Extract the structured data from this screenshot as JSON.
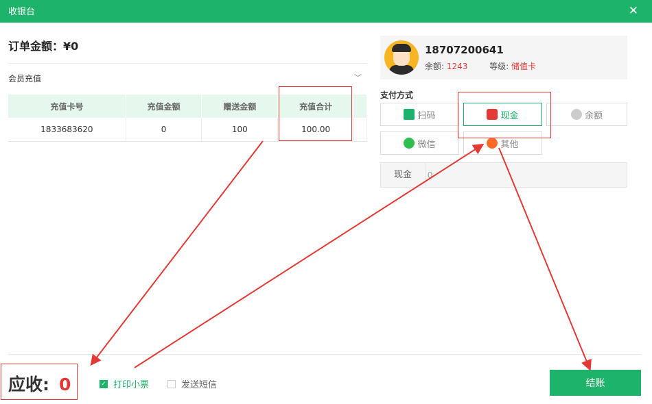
{
  "window": {
    "title": "收银台",
    "close_glyph": "✕"
  },
  "order": {
    "amount_label": "订单金额：",
    "amount_value": "¥0"
  },
  "section": {
    "selected": "会员充值"
  },
  "table": {
    "headers": [
      "充值卡号",
      "充值金额",
      "赠送金额",
      "充值合计"
    ],
    "rows": [
      [
        "1833683620",
        "0",
        "100",
        "100.00"
      ]
    ]
  },
  "member": {
    "phone": "18707200641",
    "balance_label": "余额:",
    "balance_value": "1243",
    "level_label": "等级:",
    "level_value": "储值卡"
  },
  "payment": {
    "title": "支付方式",
    "methods": [
      {
        "label": "扫码",
        "icon": "qr-scan-icon"
      },
      {
        "label": "现金",
        "icon": "wallet-icon",
        "active": true
      },
      {
        "label": "余额",
        "icon": "money-bag-icon"
      },
      {
        "label": "微信",
        "icon": "wechat-icon"
      },
      {
        "label": "其他",
        "icon": "more-icon"
      }
    ],
    "cash_label": "现金",
    "cash_value": "0"
  },
  "footer": {
    "receivable_label": "应收:",
    "receivable_value": "0",
    "print_receipt": "打印小票",
    "send_sms": "发送短信",
    "checkout": "结账"
  },
  "colors": {
    "primary": "#1db36a",
    "accent_red": "#e53935"
  }
}
